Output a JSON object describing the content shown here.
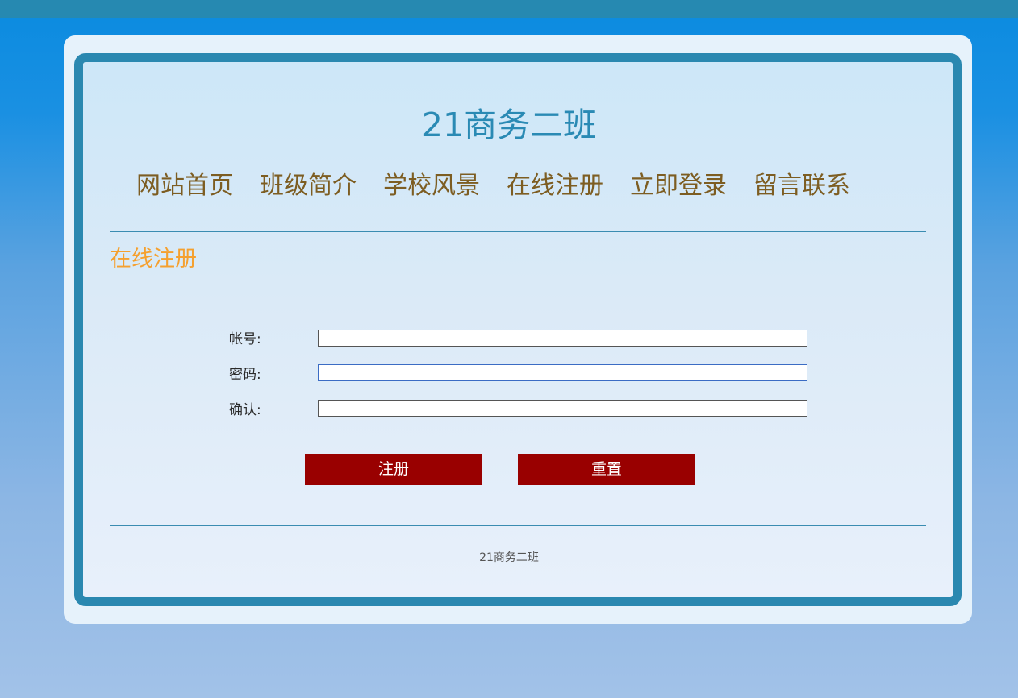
{
  "site": {
    "title": "21商务二班"
  },
  "nav": {
    "items": [
      {
        "label": "网站首页"
      },
      {
        "label": "班级简介"
      },
      {
        "label": "学校风景"
      },
      {
        "label": "在线注册"
      },
      {
        "label": "立即登录"
      },
      {
        "label": "留言联系"
      }
    ]
  },
  "section": {
    "title": "在线注册"
  },
  "form": {
    "account_label": "帐号:",
    "account_value": "",
    "password_label": "密码:",
    "password_value": "",
    "confirm_label": "确认:",
    "confirm_value": "",
    "submit_label": "注册",
    "reset_label": "重置"
  },
  "footer": {
    "text": "21商务二班"
  },
  "colors": {
    "accent": "#2a88b0",
    "nav_text": "#7d5d22",
    "section_title": "#f5a02e",
    "button": "#990000"
  }
}
